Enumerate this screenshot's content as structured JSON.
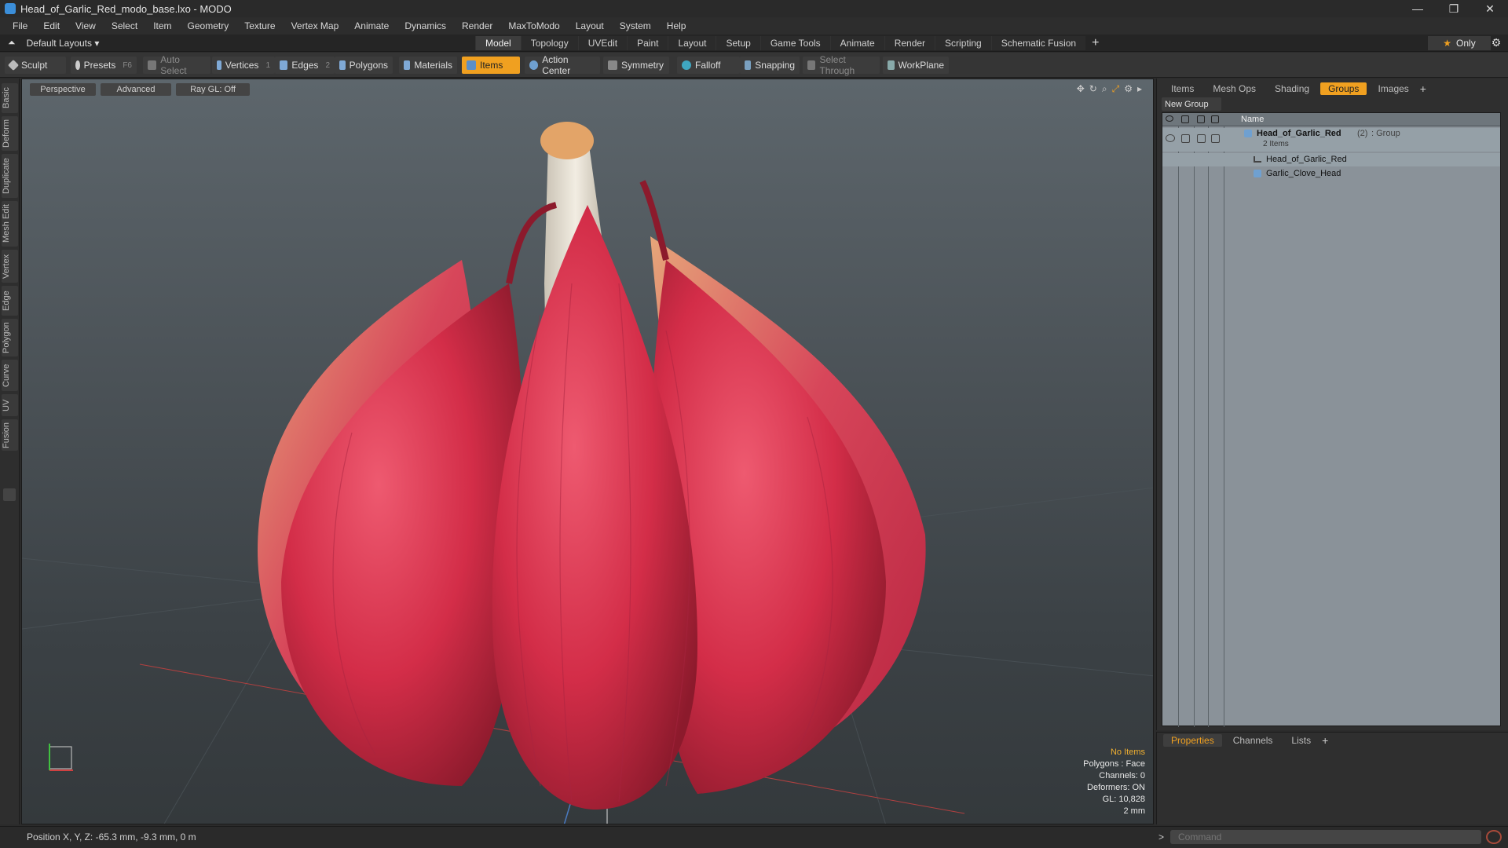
{
  "window": {
    "title": "Head_of_Garlic_Red_modo_base.lxo - MODO"
  },
  "menu": [
    "File",
    "Edit",
    "View",
    "Select",
    "Item",
    "Geometry",
    "Texture",
    "Vertex Map",
    "Animate",
    "Dynamics",
    "Render",
    "MaxToModo",
    "Layout",
    "System",
    "Help"
  ],
  "layout_selector": "Default Layouts ▾",
  "tabs": [
    "Model",
    "Topology",
    "UVEdit",
    "Paint",
    "Layout",
    "Setup",
    "Game Tools",
    "Animate",
    "Render",
    "Scripting",
    "Schematic Fusion"
  ],
  "active_tab": "Model",
  "only_button": "Only",
  "toolbar": {
    "sculpt": "Sculpt",
    "presets": "Presets",
    "presets_key": "F6",
    "auto_select": "Auto Select",
    "vertices": "Vertices",
    "vertices_key": "1",
    "edges": "Edges",
    "edges_key": "2",
    "polygons": "Polygons",
    "materials": "Materials",
    "items": "Items",
    "action_center": "Action Center",
    "symmetry": "Symmetry",
    "falloff": "Falloff",
    "snapping": "Snapping",
    "select_through": "Select Through",
    "workplane": "WorkPlane"
  },
  "left_tabs": [
    "Basic",
    "Deform",
    "Duplicate",
    "Mesh Edit",
    "Vertex",
    "Edge",
    "Polygon",
    "Curve",
    "UV",
    "Fusion"
  ],
  "viewport": {
    "view": "Perspective",
    "mode": "Advanced",
    "raygl": "Ray GL: Off",
    "hud": {
      "items": "No Items",
      "polygons": "Polygons : Face",
      "channels": "Channels: 0",
      "deformers": "Deformers: ON",
      "gl": "GL: 10,828",
      "scale": "2 mm"
    }
  },
  "right_panel": {
    "tabs": [
      "Items",
      "Mesh Ops",
      "Shading",
      "Groups",
      "Images"
    ],
    "active_tab": "Groups",
    "new_group": "New Group",
    "column_name": "Name",
    "group": {
      "name": "Head_of_Garlic_Red",
      "count": "(2)",
      "type": ": Group",
      "sub": "2 Items"
    },
    "children": [
      "Head_of_Garlic_Red",
      "Garlic_Clove_Head"
    ]
  },
  "properties_panel": {
    "tabs": [
      "Properties",
      "Channels",
      "Lists"
    ],
    "active_tab": "Properties"
  },
  "status": {
    "position": "Position X, Y, Z:  -65.3 mm, -9.3 mm, 0 m",
    "command_placeholder": "Command"
  },
  "colors": {
    "accent": "#f0a020",
    "garlic_red": "#d8344e",
    "viewport_top": "#5d666c"
  }
}
